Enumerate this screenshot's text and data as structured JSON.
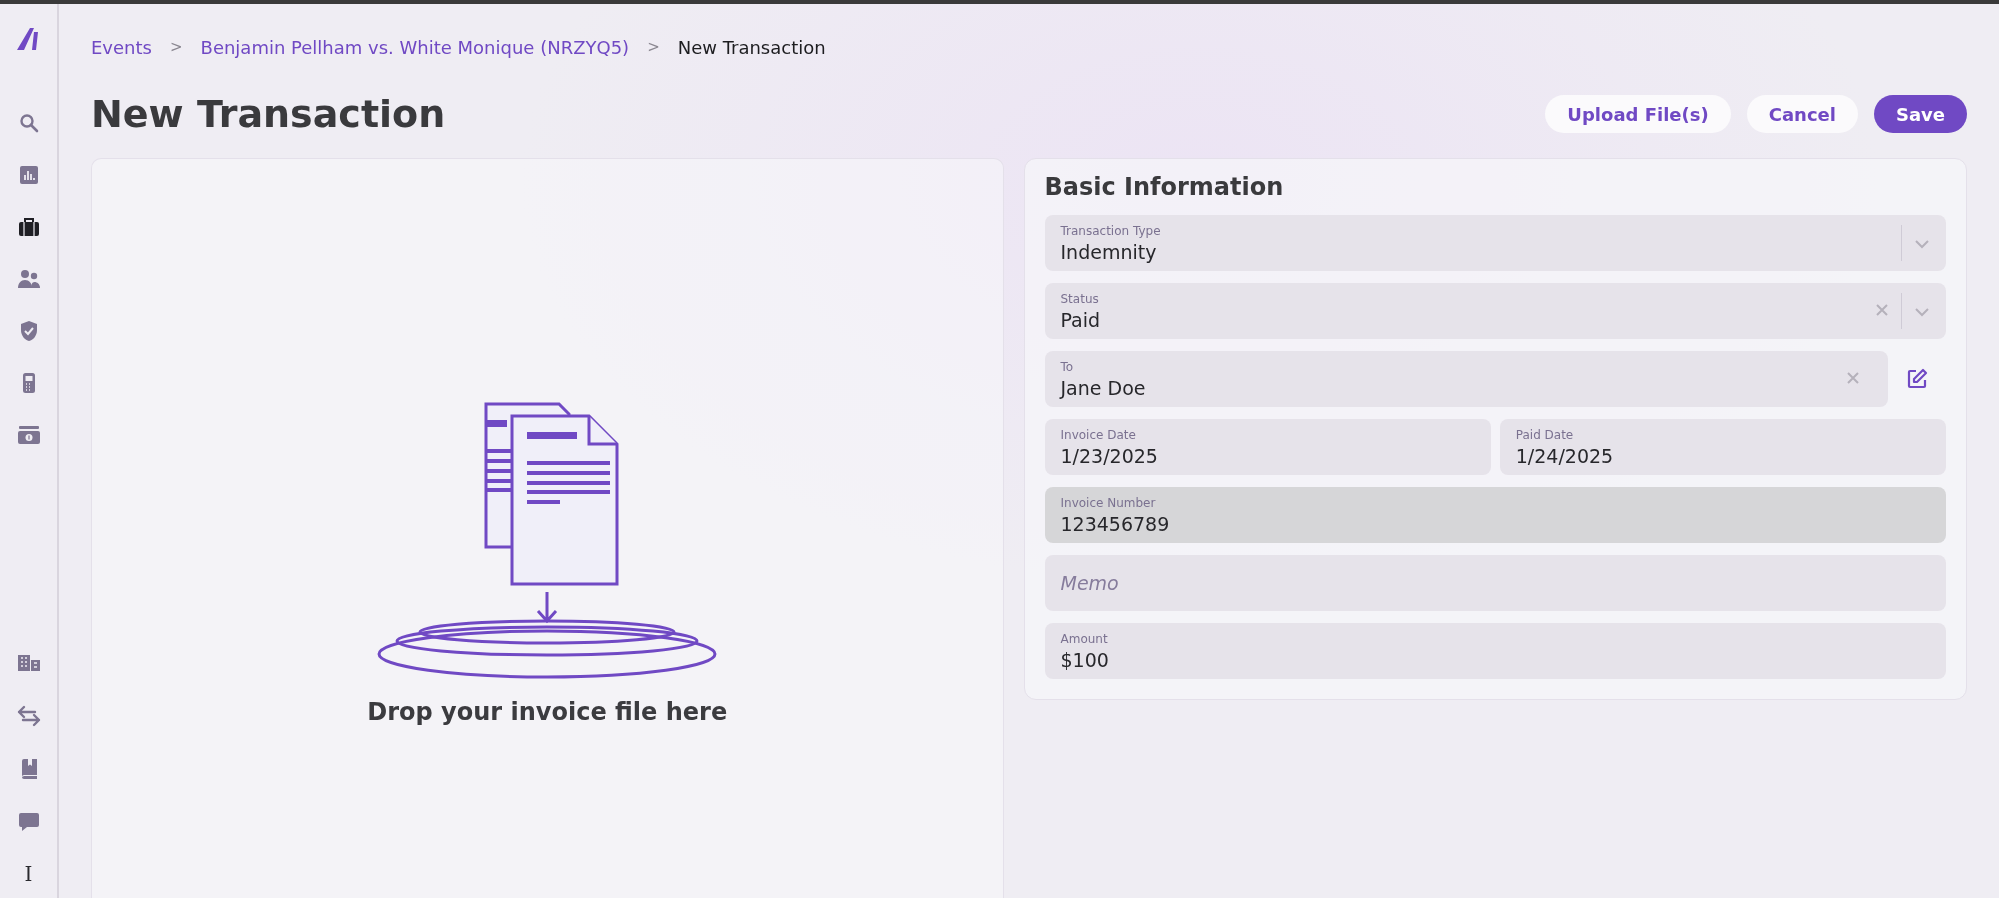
{
  "sidebar": {
    "top_items": [
      {
        "selected": false
      },
      {
        "selected": false
      },
      {
        "selected": true
      },
      {
        "selected": false
      },
      {
        "selected": false
      },
      {
        "selected": false
      },
      {
        "selected": false
      }
    ],
    "bottom_items": [
      {
        "selected": false
      },
      {
        "selected": false
      },
      {
        "selected": false
      },
      {
        "selected": false
      }
    ],
    "user_initial": "I"
  },
  "breadcrumb": [
    {
      "label": "Events",
      "current": false
    },
    {
      "label": "Benjamin Pellham vs. White Monique (NRZYQ5)",
      "current": false
    },
    {
      "label": "New Transaction",
      "current": true
    }
  ],
  "breadcrumb_separator": ">",
  "title": "New Transaction",
  "actions": [
    {
      "label": "Upload File(s)",
      "primary": false
    },
    {
      "label": "Cancel",
      "primary": false
    },
    {
      "label": "Save",
      "primary": true
    }
  ],
  "dropzone": {
    "text": "Drop your invoice file here"
  },
  "form": {
    "title": "Basic Information",
    "rows": [
      {
        "fields": [
          {
            "kind": "select",
            "label": "Transaction Type",
            "value": "Indemnity",
            "clearable": false,
            "disabled": false
          }
        ]
      },
      {
        "fields": [
          {
            "kind": "select",
            "label": "Status",
            "value": "Paid",
            "clearable": true,
            "disabled": false
          }
        ]
      },
      {
        "fields": [
          {
            "kind": "text",
            "label": "To",
            "value": "Jane Doe",
            "clearable": true,
            "disabled": false,
            "editable": true
          }
        ]
      },
      {
        "fields": [
          {
            "kind": "text",
            "label": "Invoice Date",
            "value": "1/23/2025",
            "clearable": false,
            "disabled": false
          },
          {
            "kind": "text",
            "label": "Paid Date",
            "value": "1/24/2025",
            "clearable": false,
            "disabled": false
          }
        ]
      },
      {
        "fields": [
          {
            "kind": "text",
            "label": "Invoice Number",
            "value": "123456789",
            "clearable": false,
            "disabled": true
          }
        ]
      },
      {
        "fields": [
          {
            "kind": "empty",
            "placeholder": "Memo",
            "clearable": false,
            "disabled": false
          }
        ]
      },
      {
        "fields": [
          {
            "kind": "text",
            "label": "Amount",
            "value": "$100",
            "clearable": false,
            "disabled": false
          }
        ]
      }
    ]
  }
}
